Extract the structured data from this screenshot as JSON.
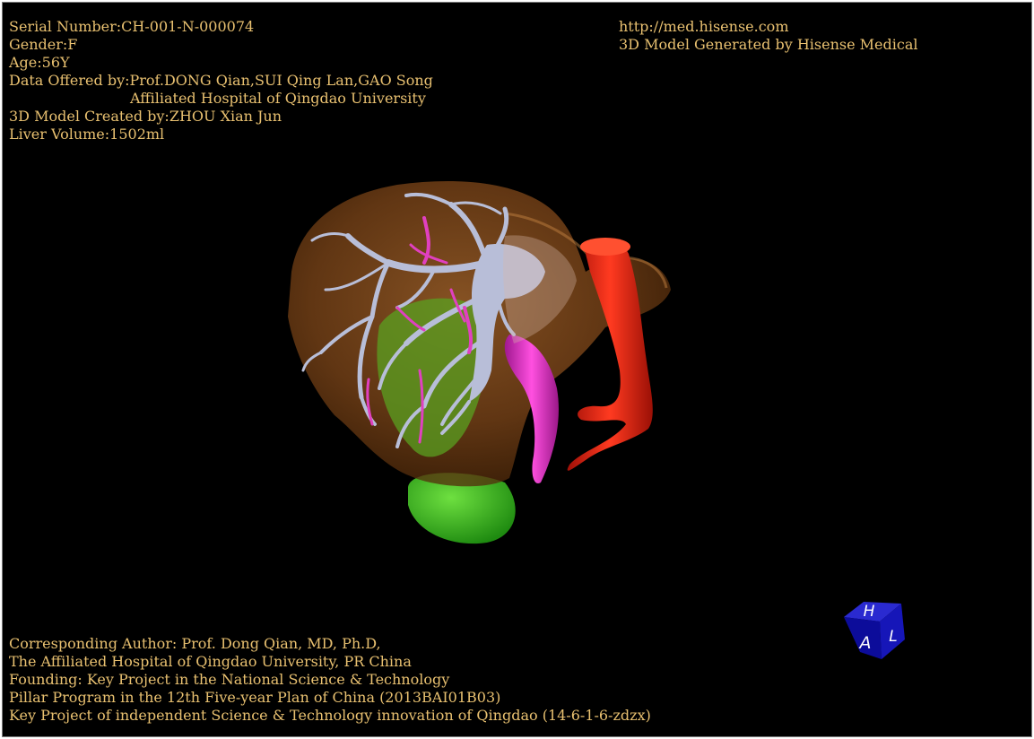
{
  "info_top_left": {
    "serial_number": "Serial Number:CH-001-N-000074",
    "gender": "Gender:F",
    "age": "Age:56Y",
    "data_offered_by": "Data Offered by:Prof.DONG Qian,SUI Qing Lan,GAO Song",
    "hospital": "Affiliated Hospital of Qingdao University",
    "model_created_by": "3D Model Created by:ZHOU Xian Jun",
    "liver_volume": "Liver Volume:1502ml"
  },
  "info_top_right": {
    "url": "http://med.hisense.com",
    "generated_by": "3D Model Generated by Hisense Medical"
  },
  "info_bottom_left": {
    "line1": "Corresponding Author: Prof. Dong Qian, MD, Ph.D,",
    "line2": "The Affiliated Hospital of Qingdao University, PR China",
    "line3": "Founding: Key Project in the National Science & Technology",
    "line4": "Pillar Program in the 12th Five-year Plan of China (2013BAI01B03)",
    "line5": "Key Project of independent Science & Technology innovation of Qingdao (14-6-1-6-zdzx)"
  },
  "orientation_cube": {
    "face_top": "H",
    "face_front": "A",
    "face_side": "L"
  },
  "colors": {
    "text": "#e8c070",
    "background": "#000000",
    "liver": "#8a4f1c",
    "portal_vein": "#b8bed8",
    "hepatic_artery": "#e040c0",
    "gallbladder": "#38c020",
    "ivc": "#e82010",
    "cube": "#1010a0"
  }
}
